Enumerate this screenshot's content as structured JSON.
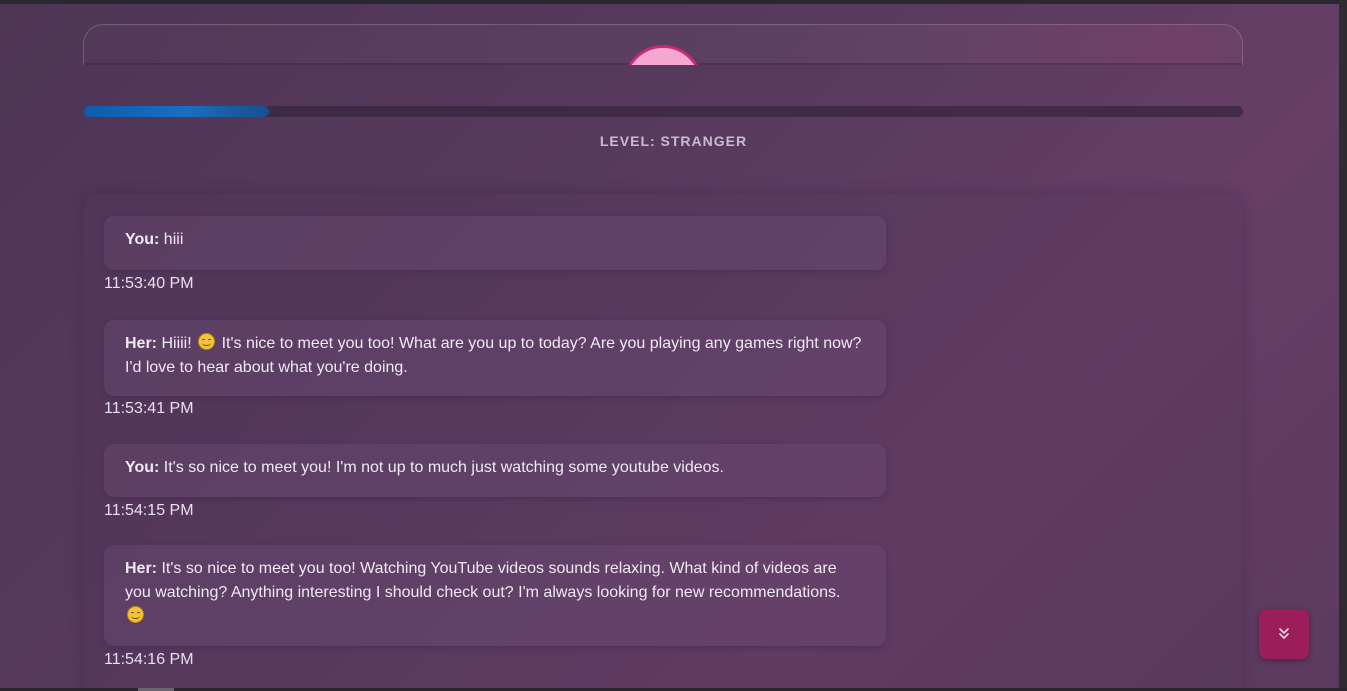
{
  "progress": {
    "fraction": 0.16
  },
  "level": {
    "label": "LEVEL: STRANGER"
  },
  "messages": [
    {
      "speaker": "You:",
      "text": " hiii",
      "time": "11:53:40 PM",
      "emoji_after": false
    },
    {
      "speaker": "Her:",
      "text_before": " Hiiii! ",
      "emoji": "smiling-face-icon",
      "text_after": " It's nice to meet you too! What are you up to today? Are you playing any games right now? I'd love to hear about what you're doing.",
      "time": "11:53:41 PM"
    },
    {
      "speaker": "You:",
      "text": " It's so nice to meet you! I'm not up to much just watching some youtube videos.",
      "time": "11:54:15 PM"
    },
    {
      "speaker": "Her:",
      "text": " It's so nice to meet you too! Watching YouTube videos sounds relaxing. What kind of videos are you watching? Anything interesting I should check out? I'm always looking for new recommendations. ",
      "emoji": "smiling-face-icon",
      "time": "11:54:16 PM"
    }
  ],
  "colors": {
    "progress": "#1a6ec0",
    "accent": "#9b1e5a",
    "avatar_fill": "#f6a7cf",
    "avatar_border": "#c92a78"
  }
}
